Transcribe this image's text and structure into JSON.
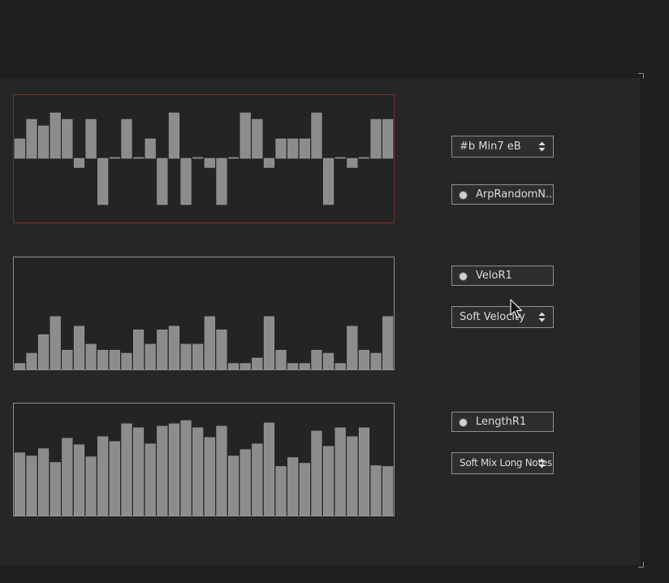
{
  "pitch_select": {
    "value": "#b Min7 eB",
    "icon": "up-down-arrows-icon"
  },
  "arp_toggle": {
    "label": "ArpRandomN..."
  },
  "velo_toggle": {
    "label": "VeloR1"
  },
  "velocity_select": {
    "value": "Soft Velocity",
    "icon": "up-down-arrows-icon"
  },
  "length_toggle": {
    "label": "LengthR1"
  },
  "length_select": {
    "value": "Soft Mix Long Notes",
    "icon": "up-down-arrows-icon"
  },
  "colors": {
    "background": "#262626",
    "bar_fill": "#8c8c8c",
    "pitch_border": "#7a2f2f",
    "graph_border": "#8e8e8e"
  },
  "chart_data": [
    {
      "type": "bar",
      "role": "pitch-steps",
      "bipolar": true,
      "ylim": [
        -5,
        7
      ],
      "values": [
        3,
        6,
        5,
        7,
        6,
        -1,
        6,
        -5,
        0,
        6,
        0,
        3,
        -5,
        7,
        -5,
        0,
        -1,
        -5,
        0,
        7,
        6,
        -1,
        3,
        3,
        3,
        7,
        -5,
        0,
        -1,
        0,
        6,
        6
      ]
    },
    {
      "type": "bar",
      "role": "velocity-steps",
      "ylim": [
        0,
        127
      ],
      "values": [
        10,
        27,
        58,
        88,
        32,
        72,
        42,
        32,
        32,
        27,
        66,
        42,
        66,
        72,
        42,
        42,
        88,
        66,
        10,
        10,
        19,
        88,
        32,
        10,
        10,
        32,
        27,
        10,
        72,
        32,
        27,
        88
      ]
    },
    {
      "type": "bar",
      "role": "length-steps",
      "ylim": [
        0,
        127
      ],
      "values": [
        78,
        74,
        83,
        66,
        96,
        88,
        73,
        98,
        92,
        114,
        109,
        89,
        111,
        114,
        118,
        109,
        97,
        111,
        74,
        82,
        89,
        115,
        61,
        72,
        65,
        105,
        86,
        109,
        98,
        109,
        62,
        61
      ]
    }
  ]
}
